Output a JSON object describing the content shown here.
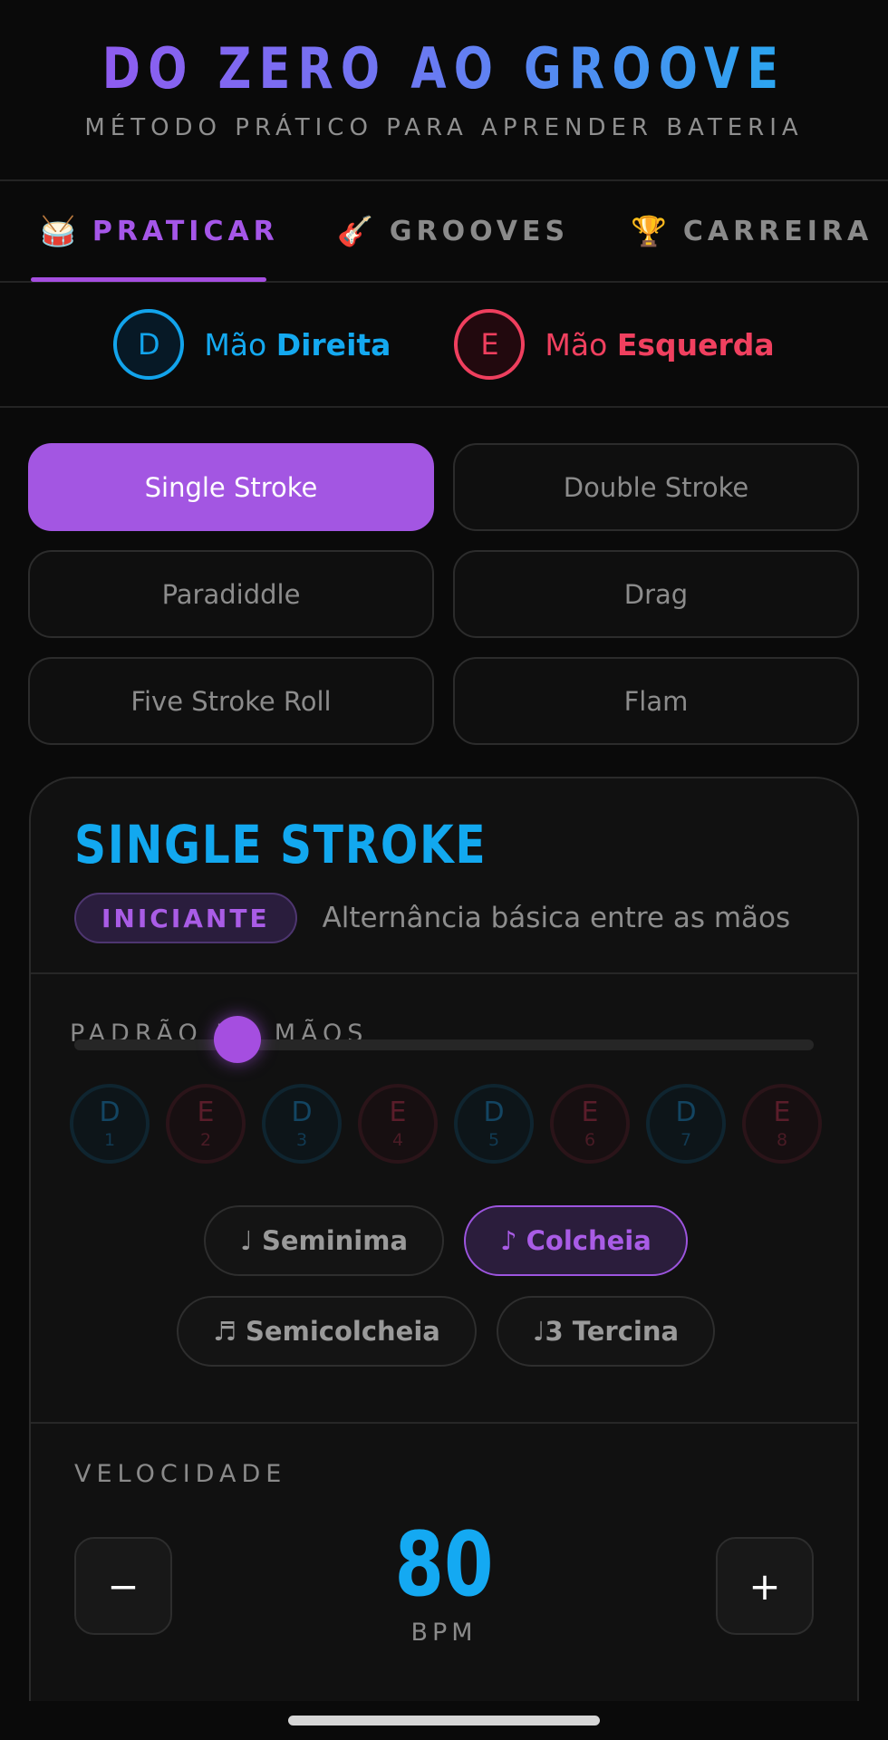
{
  "header": {
    "title": "DO ZERO AO GROOVE",
    "subtitle": "MÉTODO PRÁTICO PARA APRENDER BATERIA"
  },
  "tabs": [
    {
      "icon": "🥁",
      "icon_name": "drum-icon",
      "label": "PRATICAR",
      "active": true
    },
    {
      "icon": "🎸",
      "icon_name": "guitar-icon",
      "label": "GROOVES",
      "active": false
    },
    {
      "icon": "🏆",
      "icon_name": "trophy-icon",
      "label": "CARREIRA",
      "active": false
    }
  ],
  "legend": {
    "right": {
      "letter": "D",
      "prefix": "Mão",
      "name": "Direita"
    },
    "left": {
      "letter": "E",
      "prefix": "Mão",
      "name": "Esquerda"
    }
  },
  "rudiments": [
    {
      "label": "Single Stroke",
      "active": true
    },
    {
      "label": "Double Stroke",
      "active": false
    },
    {
      "label": "Paradiddle",
      "active": false
    },
    {
      "label": "Drag",
      "active": false
    },
    {
      "label": "Five Stroke Roll",
      "active": false
    },
    {
      "label": "Flam",
      "active": false
    }
  ],
  "card": {
    "title": "SINGLE STROKE",
    "level": "INICIANTE",
    "description": "Alternância básica entre as mãos",
    "pattern_label": "PADRÃO DE MÃOS",
    "pattern": [
      {
        "hand": "D",
        "num": "1"
      },
      {
        "hand": "E",
        "num": "2"
      },
      {
        "hand": "D",
        "num": "3"
      },
      {
        "hand": "E",
        "num": "4"
      },
      {
        "hand": "D",
        "num": "5"
      },
      {
        "hand": "E",
        "num": "6"
      },
      {
        "hand": "D",
        "num": "7"
      },
      {
        "hand": "E",
        "num": "8"
      }
    ],
    "subdivisions": [
      {
        "label": "♩ Seminima",
        "active": false
      },
      {
        "label": "♪ Colcheia",
        "active": true
      },
      {
        "label": "♬ Semicolcheia",
        "active": false
      },
      {
        "label": "♩3 Tercina",
        "active": false
      }
    ],
    "speed": {
      "label": "VELOCIDADE",
      "bpm": "80",
      "unit": "BPM",
      "minus": "−",
      "plus": "+",
      "slider_fraction": 0.22
    }
  },
  "colors": {
    "accent_purple": "#a356e2",
    "right_hand_blue": "#12a4ec",
    "left_hand_red": "#ef3f5e"
  }
}
